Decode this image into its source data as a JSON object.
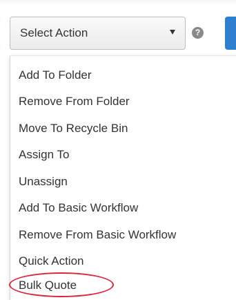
{
  "toolbar": {
    "select_action": {
      "label": "Select Action",
      "caret_icon": "caret-down-icon"
    },
    "help_icon": {
      "glyph": "?",
      "icon": "question-circle-icon"
    },
    "action_button_color": "#2e7fcf"
  },
  "menu": {
    "items": [
      {
        "label": "Add To Folder"
      },
      {
        "label": "Remove From Folder"
      },
      {
        "label": "Move To Recycle Bin"
      },
      {
        "label": "Assign To"
      },
      {
        "label": "Unassign"
      },
      {
        "label": "Add To Basic Workflow"
      },
      {
        "label": "Remove From Basic Workflow"
      },
      {
        "label": "Quick Action"
      },
      {
        "label": "Bulk Quote"
      }
    ]
  },
  "annotation": {
    "highlighted_item": "Bulk Quote",
    "ring_color": "#e0223a"
  }
}
